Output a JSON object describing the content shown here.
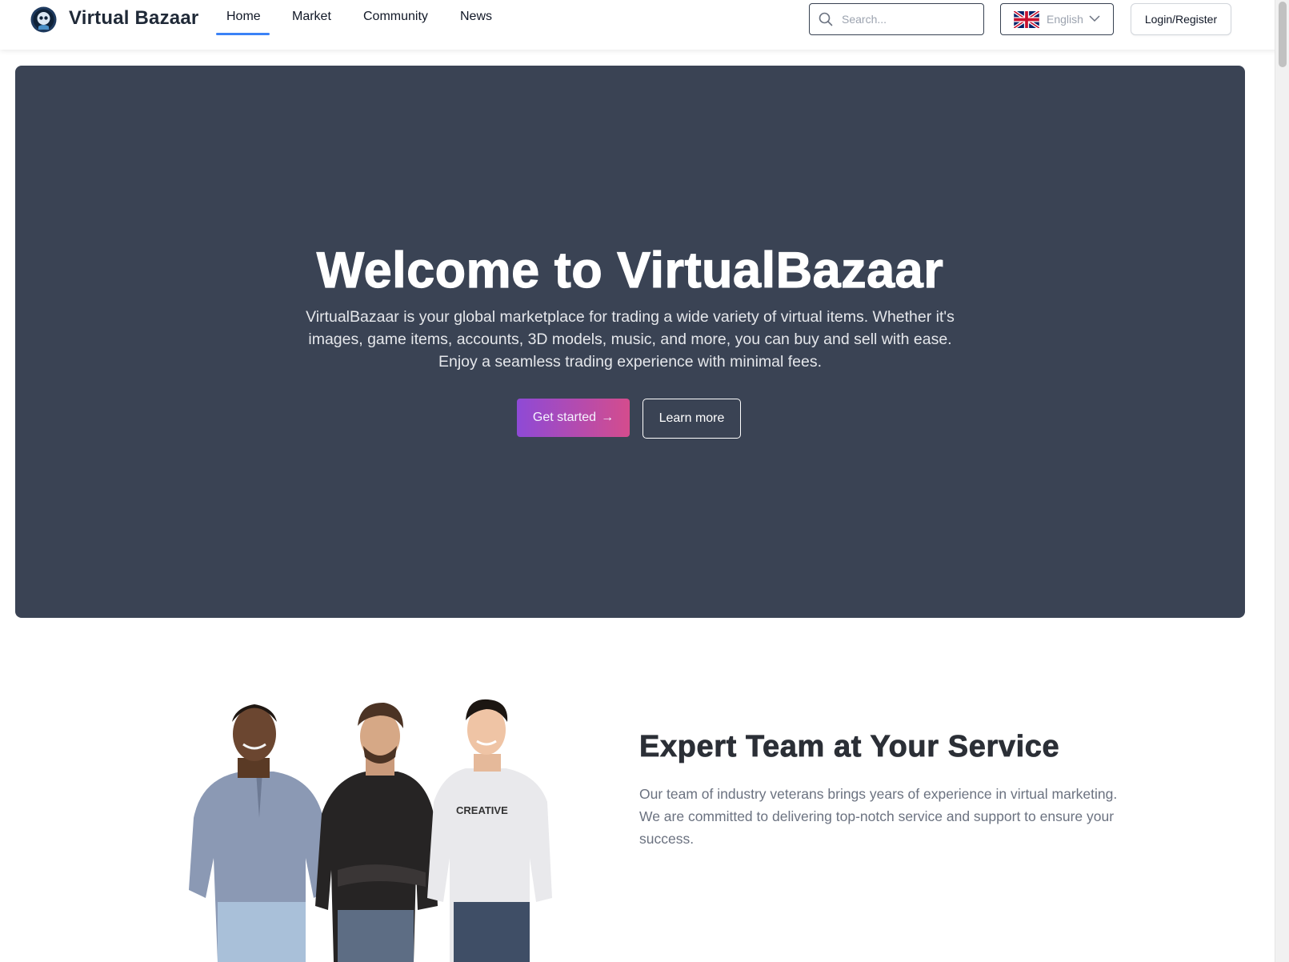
{
  "header": {
    "brand": "Virtual Bazaar",
    "nav": {
      "home": "Home",
      "market": "Market",
      "community": "Community",
      "news": "News"
    },
    "active_nav": "Home",
    "search_placeholder": "Search...",
    "language": "English",
    "login_label": "Login/Register"
  },
  "hero": {
    "title": "Welcome to VirtualBazaar",
    "description": "VirtualBazaar is your global marketplace for trading a wide variety of virtual items. Whether it's images, game items, accounts, 3D models, music, and more, you can buy and sell with ease. Enjoy a seamless trading experience with minimal fees.",
    "primary_button": "Get started",
    "secondary_button": "Learn more"
  },
  "team": {
    "title": "Expert Team at Your Service",
    "description": "Our team of industry veterans brings years of experience in virtual marketing. We are committed to delivering top-notch service and support to ensure your success.",
    "shirt_text": "CREATIVE"
  },
  "colors": {
    "accent": "#3b82f6",
    "hero_bg": "#3a4354",
    "gradient_start": "#8e4ad6",
    "gradient_end": "#d44c8d"
  }
}
